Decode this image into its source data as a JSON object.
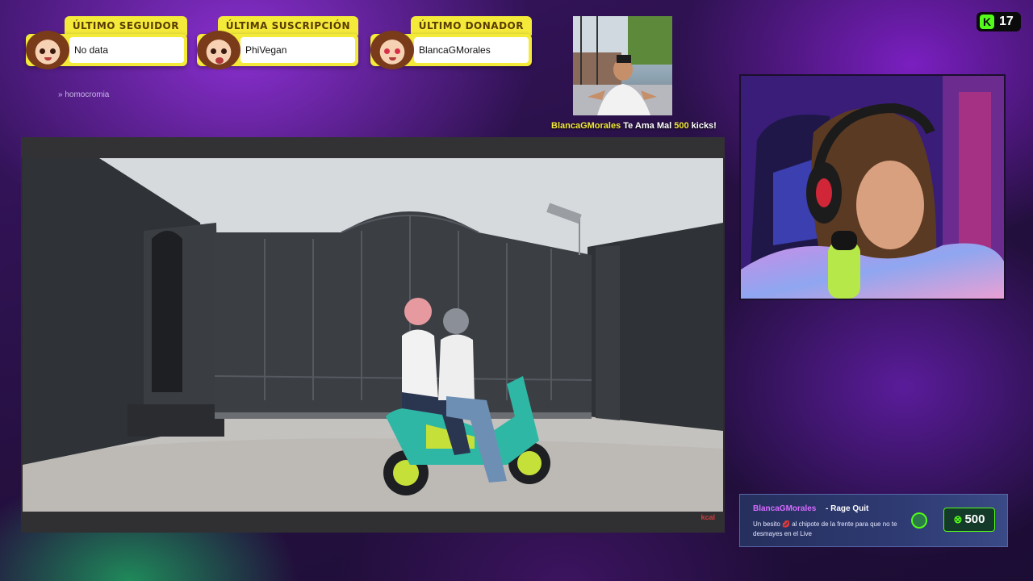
{
  "alerts": {
    "follower": {
      "label": "ÚLTIMO SEGUIDOR",
      "value": "No data"
    },
    "subscription": {
      "label": "ÚLTIMA SUSCRIPCIÓN",
      "value": "PhiVegan"
    },
    "donor": {
      "label": "ÚLTIMO DONADOR",
      "value": "BlancaGMorales"
    }
  },
  "streamer_credit": "homocromia",
  "clip": {
    "user": "BlancaGMorales",
    "text_before": " Te Ama Mal ",
    "amount": "500",
    "text_after": " kicks!"
  },
  "viewers": {
    "count": "17",
    "platform_icon": "K"
  },
  "video": {
    "watermark": "kcal"
  },
  "donation": {
    "user": "BlancaGMorales",
    "reward": "- Rage Quit",
    "message": "Un besito 💋 al chipote de la frente para que no te desmayes en el Live",
    "amount": "500",
    "coin_symbol": "⊗"
  },
  "colors": {
    "accent_yellow": "#f3ea3a",
    "kick_green": "#53fc18",
    "donation_bg": "#2e3a72"
  }
}
